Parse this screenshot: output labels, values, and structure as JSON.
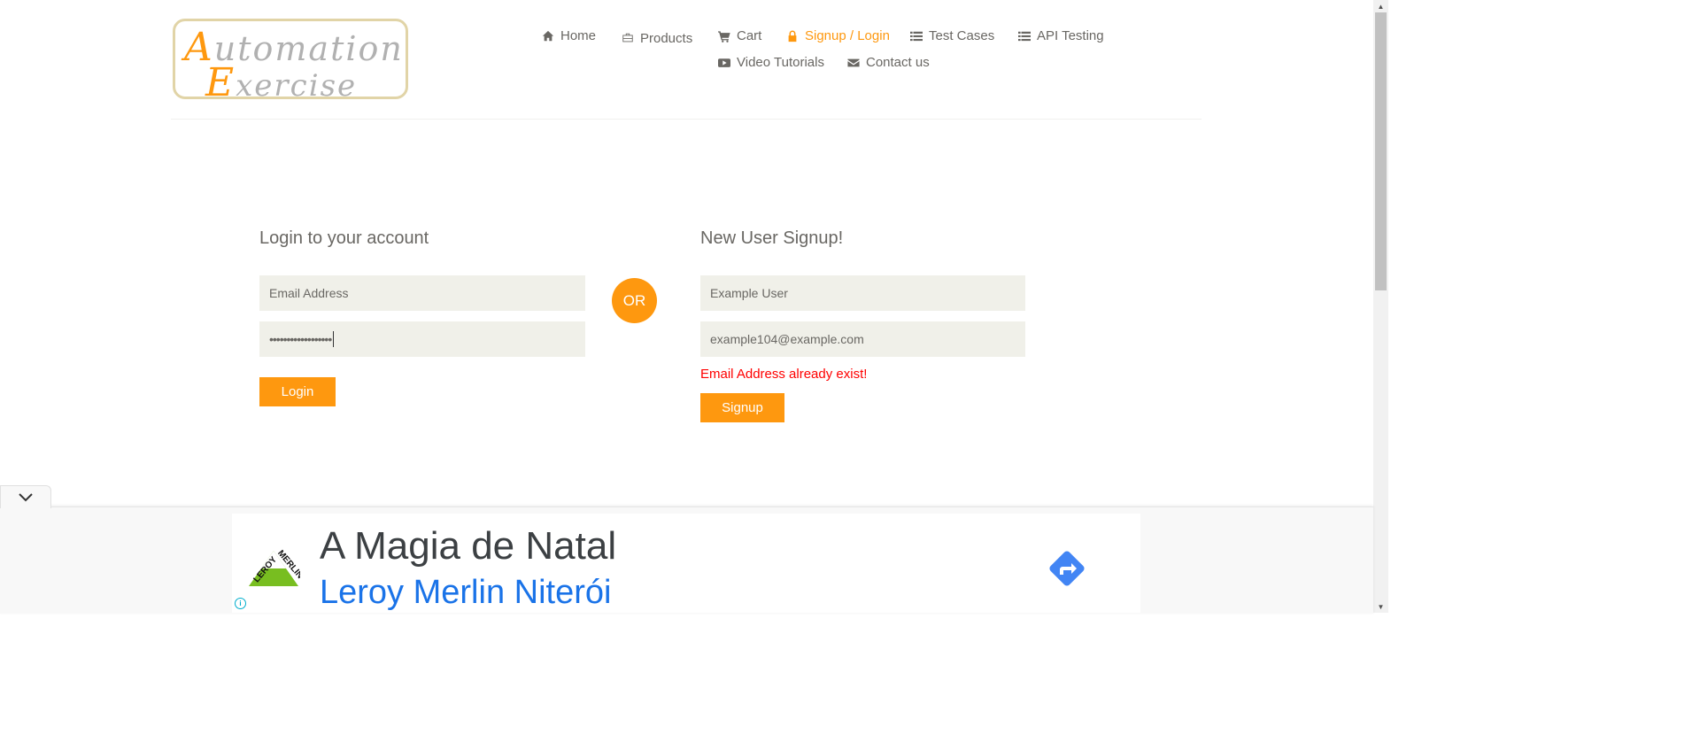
{
  "logo": {
    "line1_cap": "A",
    "line1_rest": "utomation",
    "line2_cap": "E",
    "line2_rest": "xercise"
  },
  "nav": {
    "home": {
      "label": "Home",
      "icon": "home-icon"
    },
    "products": {
      "label": "Products",
      "icon": "briefcase-icon"
    },
    "cart": {
      "label": "Cart",
      "icon": "cart-icon"
    },
    "login": {
      "label": "Signup / Login",
      "icon": "lock-icon",
      "active": true
    },
    "test_cases": {
      "label": "Test Cases",
      "icon": "list-icon"
    },
    "api_testing": {
      "label": "API Testing",
      "icon": "list-icon"
    },
    "video": {
      "label": "Video Tutorials",
      "icon": "youtube-play-icon"
    },
    "contact": {
      "label": "Contact us",
      "icon": "envelope-icon"
    }
  },
  "login_form": {
    "title": "Login to your account",
    "email_placeholder": "Email Address",
    "password_value": "••••••••••••••••••",
    "button": "Login"
  },
  "divider_text": "OR",
  "signup_form": {
    "title": "New User Signup!",
    "name_value": "Example User",
    "email_value": "example104@example.com",
    "error": "Email Address already exist!",
    "button": "Signup"
  },
  "ad": {
    "headline": "A Magia de Natal",
    "subline": "Leroy Merlin Niterói",
    "logo_text": "LEROY MERLIN",
    "info_symbol": "i"
  },
  "colors": {
    "accent": "#fe980f",
    "text": "#696763",
    "input_bg": "#f0f0e9",
    "error": "#ff0000",
    "ad_link": "#1a73e8"
  }
}
